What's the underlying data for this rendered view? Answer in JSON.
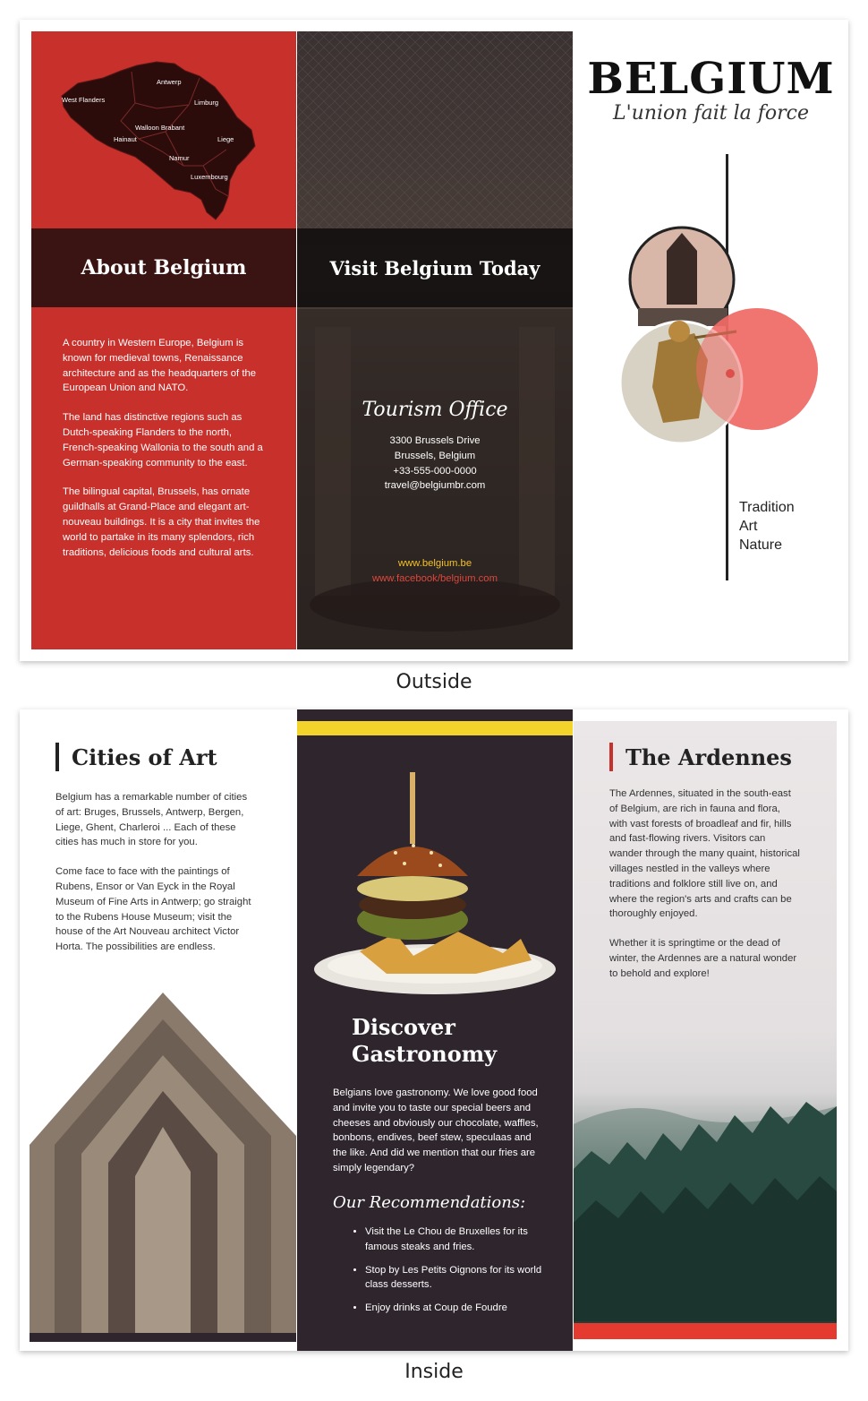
{
  "outside": {
    "caption": "Outside",
    "about": {
      "title": "About Belgium",
      "map_regions": [
        "Antwerp",
        "West Flanders",
        "Limburg",
        "Walloon Brabant",
        "Hainaut",
        "Liege",
        "Namur",
        "Luxembourg"
      ],
      "paragraphs": [
        "A country in Western Europe, Belgium is known for medieval towns, Renaissance architecture and as the headquarters of the European Union and NATO.",
        "The land has distinctive regions such as Dutch-speaking Flanders to the north, French-speaking Wallonia to the south and a German-speaking community to the east.",
        "The bilingual capital, Brussels, has ornate guildhalls at Grand-Place and elegant art-nouveau buildings. It is a city that invites the world to partake in its many splendors, rich traditions, delicious foods and cultural arts."
      ]
    },
    "visit": {
      "title": "Visit Belgium Today",
      "office_heading": "Tourism Office",
      "address_lines": [
        "3300 Brussels Drive",
        "Brussels, Belgium",
        "+33-555-000-0000",
        "travel@belgiumbr.com"
      ],
      "web": "www.belgium.be",
      "facebook": "www.facebook/belgium.com"
    },
    "cover": {
      "title": "BELGIUM",
      "motto": "L'union fait la force",
      "keywords": [
        "Tradition",
        "Art",
        "Nature"
      ]
    }
  },
  "inside": {
    "caption": "Inside",
    "cities": {
      "title": "Cities of Art",
      "paragraphs": [
        "Belgium has a remarkable number of cities of art: Bruges, Brussels, Antwerp, Bergen, Liege, Ghent, Charleroi ... Each of these cities has much in store for you.",
        "Come face to face with the paintings of Rubens, Ensor or Van Eyck in the Royal Museum of Fine Arts in Antwerp; go straight to the Rubens House Museum; visit the house of the Art Nouveau architect Victor Horta. The possibilities are endless."
      ]
    },
    "gastronomy": {
      "title_line1": "Discover",
      "title_line2": "Gastronomy",
      "paragraph": "Belgians love gastronomy. We love good food and invite you to taste our special beers and cheeses and obviously our chocolate, waffles, bonbons, endives, beef stew, speculaas and the like. And did we mention that our fries are simply legendary?",
      "recommend_heading": "Our Recommendations:",
      "recommendations": [
        "Visit the Le Chou de Bruxelles for its famous steaks and fries.",
        "Stop by Les Petits Oignons for its world class desserts.",
        "Enjoy drinks at Coup de Foudre"
      ]
    },
    "ardennes": {
      "title": "The Ardennes",
      "paragraphs": [
        "The Ardennes, situated in the south-east of Belgium, are rich in fauna and flora, with vast forests of broadleaf and fir, hills and fast-flowing rivers. Visitors can wander through the many quaint, historical villages nestled in the valleys where traditions and folklore still live on, and where the region's arts and crafts can be thoroughly enjoyed.",
        "Whether it is springtime or the dead of winter, the Ardennes are a natural wonder to behold and explore!"
      ]
    }
  },
  "colors": {
    "red": "#c8302c",
    "dark": "#2b1a1a",
    "maroon": "#3a1412",
    "yellow": "#f2d42a",
    "plum": "#2e252d",
    "salmon": "#ee6a66"
  }
}
